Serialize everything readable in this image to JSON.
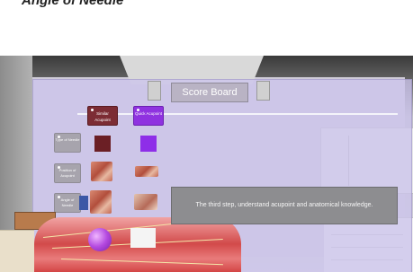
{
  "caption": "Angle of Needle",
  "scene": {
    "title": "Score Board",
    "buttons": [
      {
        "label": "Similar Acupoint",
        "color": "#7c2c34"
      },
      {
        "label": "Quick Acupoint",
        "color": "#8f32e0"
      }
    ],
    "rows": [
      {
        "label": "Type of Needle"
      },
      {
        "label": "Position of Acupoint"
      },
      {
        "label": "Angle of Needle"
      }
    ],
    "dialog": "The third step, understand acupoint and anatomical knowledge."
  }
}
